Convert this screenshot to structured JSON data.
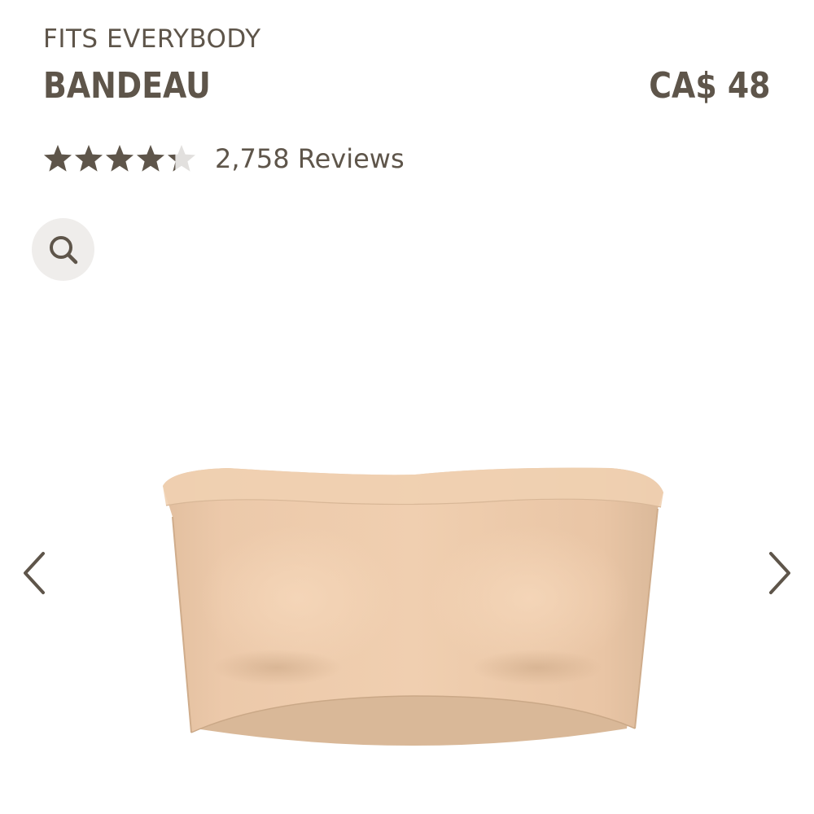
{
  "product": {
    "collection": "FITS EVERYBODY",
    "name": "BANDEAU",
    "price": "CA$ 48",
    "rating": 4.3,
    "rating_max": 5,
    "reviews_label": "2,758 Reviews",
    "image_name": "bandeau-product-image"
  },
  "colors": {
    "text": "#5e554a",
    "star_filled": "#5e554a",
    "star_empty": "#e2e0de",
    "zoom_bg": "#efedeb",
    "product": "#ecc9a9"
  },
  "icons": {
    "zoom": "search-icon",
    "prev": "chevron-left-icon",
    "next": "chevron-right-icon",
    "star": "star-icon"
  }
}
